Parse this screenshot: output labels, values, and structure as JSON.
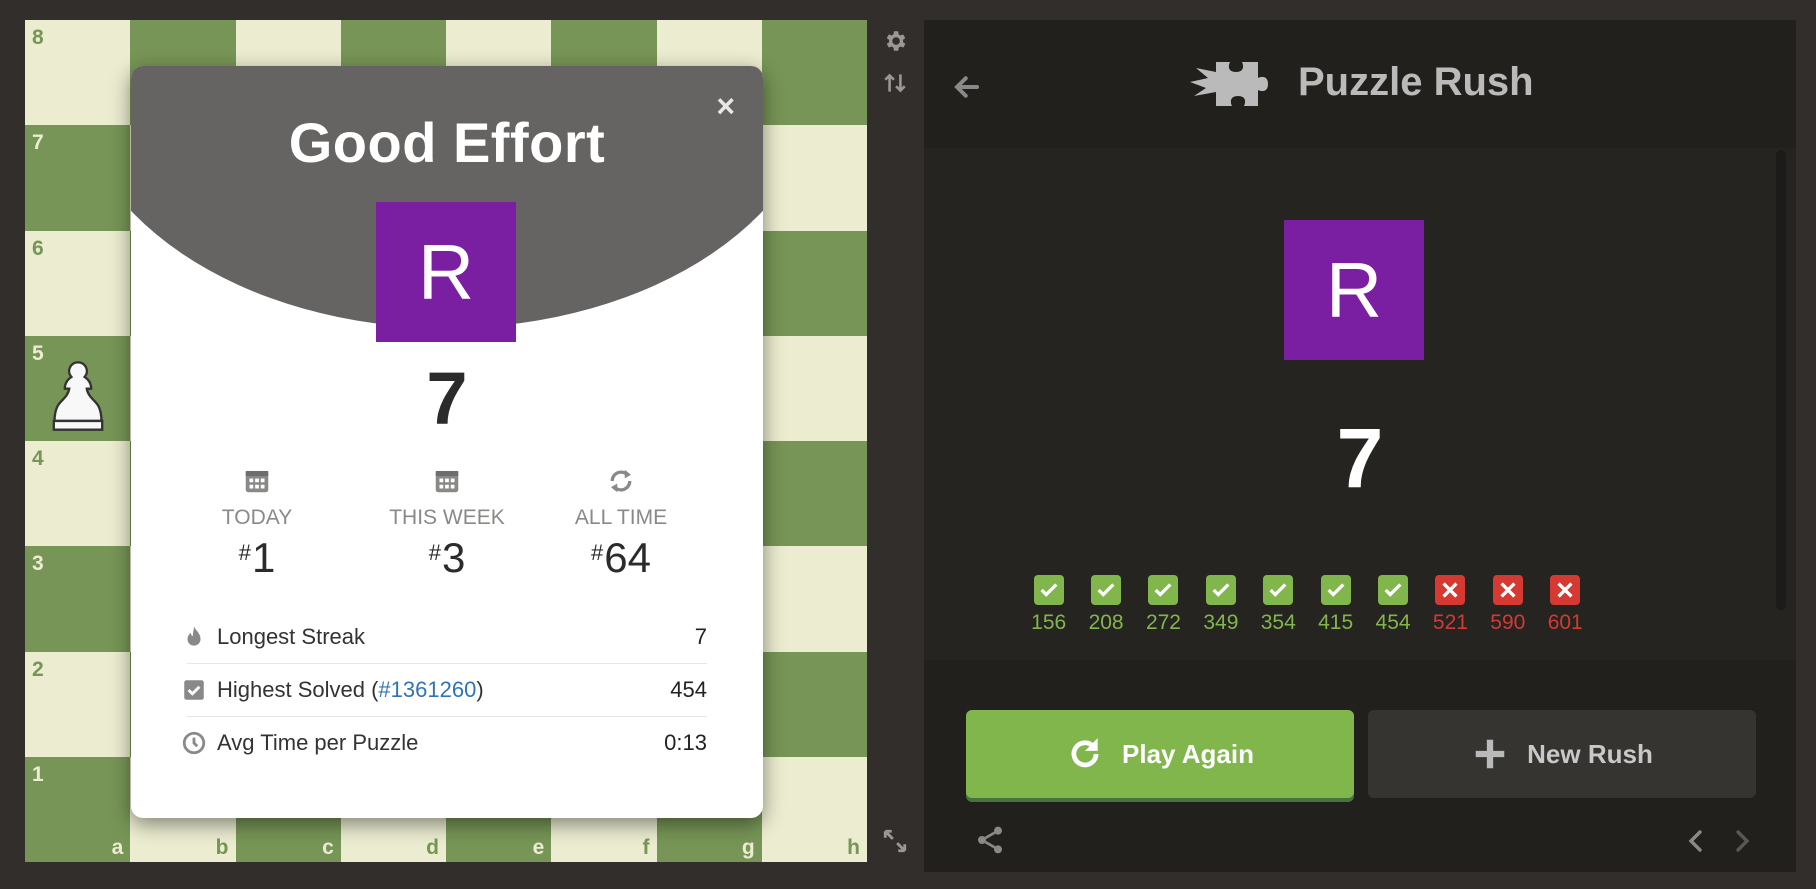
{
  "board": {
    "ranks": [
      "8",
      "7",
      "6",
      "5",
      "4",
      "3",
      "2",
      "1"
    ],
    "files": [
      "a",
      "b",
      "c",
      "d",
      "e",
      "f",
      "g",
      "h"
    ]
  },
  "modal": {
    "title": "Good Effort",
    "close": "×",
    "avatar_letter": "R",
    "score": "7",
    "rankings": [
      {
        "label": "TODAY",
        "hash": "#",
        "value": "1",
        "icon": "calendar-icon"
      },
      {
        "label": "THIS WEEK",
        "hash": "#",
        "value": "3",
        "icon": "calendar-icon"
      },
      {
        "label": "ALL TIME",
        "hash": "#",
        "value": "64",
        "icon": "refresh-icon"
      }
    ],
    "stats": {
      "longest_streak": {
        "label": "Longest Streak",
        "value": "7"
      },
      "highest_solved": {
        "label_pre": "Highest Solved (",
        "link": "#1361260",
        "label_post": ")",
        "value": "454"
      },
      "avg_time": {
        "label": "Avg Time per Puzzle",
        "value": "0:13"
      }
    }
  },
  "panel": {
    "title": "Puzzle Rush",
    "avatar_letter": "R",
    "score": "7",
    "results": [
      {
        "value": "156",
        "ok": true
      },
      {
        "value": "208",
        "ok": true
      },
      {
        "value": "272",
        "ok": true
      },
      {
        "value": "349",
        "ok": true
      },
      {
        "value": "354",
        "ok": true
      },
      {
        "value": "415",
        "ok": true
      },
      {
        "value": "454",
        "ok": true
      },
      {
        "value": "521",
        "ok": false
      },
      {
        "value": "590",
        "ok": false
      },
      {
        "value": "601",
        "ok": false
      }
    ],
    "play_again": "Play Again",
    "new_rush": "New Rush"
  },
  "colors": {
    "light_square": "#ebecd0",
    "dark_square": "#779556",
    "success": "#81b64c",
    "fail": "#d43a32",
    "avatar": "#7b1fa2"
  }
}
